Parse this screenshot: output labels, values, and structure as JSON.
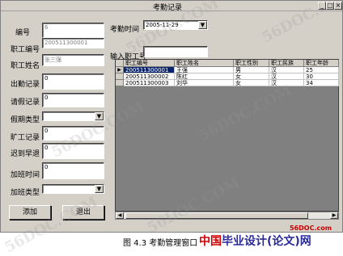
{
  "window": {
    "title": "考勤记录",
    "controls": {
      "minimize": "_",
      "maximize": "□",
      "close": "×"
    }
  },
  "form": {
    "fields": [
      {
        "label": "编号",
        "value": "6"
      },
      {
        "label": "职工编号",
        "value": "200511300001"
      },
      {
        "label": "职工姓名",
        "value": "张三强"
      },
      {
        "label": "出勤记录",
        "value": "0"
      },
      {
        "label": "请假记录",
        "value": "0"
      },
      {
        "label": "假期类型",
        "value": ""
      },
      {
        "label": "旷工记录",
        "value": "0"
      },
      {
        "label": "迟到早退",
        "value": "0"
      },
      {
        "label": "加班时间",
        "value": "0"
      },
      {
        "label": "加班类型",
        "value": ""
      }
    ],
    "add_label": "添加",
    "exit_label": "退出"
  },
  "query": {
    "date_label": "考勤时间",
    "date_value": "2005-11-29",
    "employee_label": "输入职工号",
    "employee_value": ""
  },
  "table": {
    "columns": [
      "职工编号",
      "职工姓名",
      "职工性别",
      "职工民族",
      "职工年龄"
    ],
    "rows": [
      [
        "200511300001",
        "王强",
        "男",
        "汉",
        "25"
      ],
      [
        "200511300002",
        "陈红",
        "女",
        "汉",
        "30"
      ],
      [
        "200511300003",
        "刘华",
        "女",
        "汉",
        "34"
      ]
    ],
    "selected_row": 0,
    "row_marker": "▶"
  },
  "watermarks": [
    "56DOC.COM",
    "56DOC.COM",
    "56DOC.COM",
    "56DOC.COM",
    "56DOC.COM",
    "56DOC.COM"
  ],
  "footer": {
    "caption": "图 4.3 考勤管理窗口",
    "site": "56DOC.com",
    "brand_prefix": "中国",
    "brand_main": "毕业设计(论文)网"
  }
}
